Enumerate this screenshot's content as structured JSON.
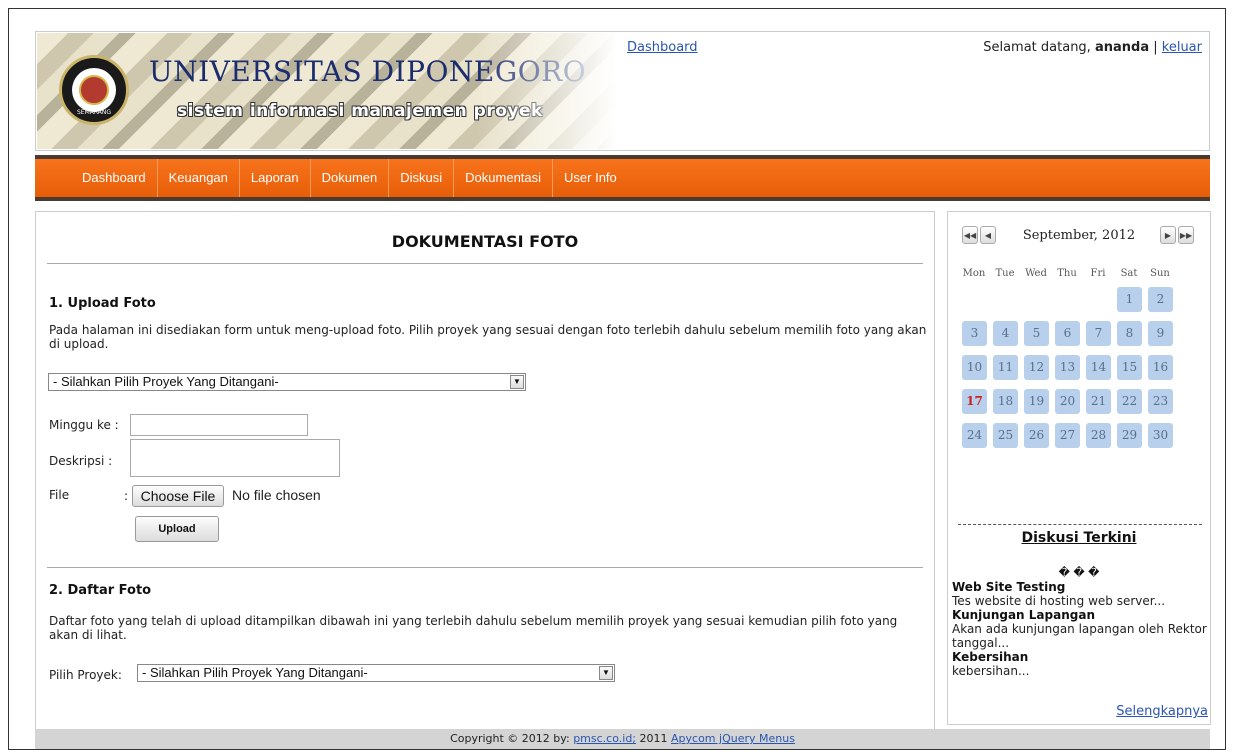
{
  "header": {
    "university": "UNIVERSITAS DIPONEGORO",
    "subtitle": "sistem informasi manajemen proyek",
    "seal_text": "SEMARANG",
    "top_link": "Dashboard",
    "welcome_prefix": "Selamat datang,",
    "username": "ananda",
    "separator": "|",
    "logout": "keluar"
  },
  "menu": [
    "Dashboard",
    "Keuangan",
    "Laporan",
    "Dokumen",
    "Diskusi",
    "Dokumentasi",
    "User Info"
  ],
  "main": {
    "title": "DOKUMENTASI FOTO",
    "upload": {
      "heading": "1. Upload Foto",
      "description": "Pada halaman ini disediakan form untuk meng-upload foto. Pilih proyek yang sesuai dengan foto terlebih dahulu sebelum memilih foto yang akan di upload.",
      "project_select": "- Silahkan Pilih Proyek Yang Ditangani-",
      "week_label": "Minggu ke :",
      "week_value": "",
      "desc_label": "Deskripsi  :",
      "desc_value": "",
      "file_label": "File",
      "file_colon": ":",
      "choose_file": "Choose File",
      "no_file": "No file chosen",
      "upload_button": "Upload"
    },
    "list": {
      "heading": "2. Daftar Foto",
      "description": "Daftar foto yang telah di upload ditampilkan dibawah ini yang terlebih dahulu sebelum memilih proyek yang sesuai kemudian pilih foto yang akan di lihat.",
      "project_label": "Pilih Proyek:",
      "project_select": "- Silahkan Pilih Proyek Yang Ditangani-"
    }
  },
  "calendar": {
    "month": "September, 2012",
    "days_of_week": [
      "Mon",
      "Tue",
      "Wed",
      "Thu",
      "Fri",
      "Sat",
      "Sun"
    ],
    "first_weekday_index": 5,
    "days_in_month": 30,
    "today": 17
  },
  "sidebar": {
    "title": "Diskusi Terkini",
    "dots": "� � �",
    "items": [
      {
        "title": "Web Site Testing",
        "text": "Tes website di hosting web server..."
      },
      {
        "title": "Kunjungan Lapangan",
        "text": "Akan ada kunjungan lapangan oleh Rektor tanggal..."
      },
      {
        "title": "Kebersihan",
        "text": "kebersihan..."
      }
    ],
    "more": "Selengkapnya"
  },
  "footer": {
    "prefix": "Copyright © 2012 by:",
    "link1": "pmsc.co.id;",
    "middle": "2011",
    "link2": "Apycom jQuery Menus"
  },
  "colors": {
    "menu_orange": "#f26a10",
    "link_blue": "#2a55b0",
    "calendar_day": "#b8d0ec",
    "today_red": "#cc2222"
  }
}
